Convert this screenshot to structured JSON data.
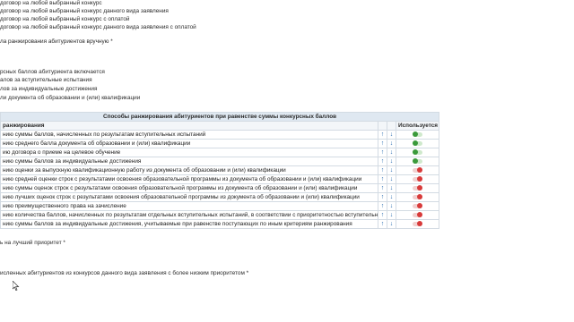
{
  "top_lines": [
    "договор на любой выбранный конкурс",
    "договор на любой выбранный конкурс данного вида заявления",
    "договор на любой выбранный конкурс с оплатой",
    "договор на любой выбранный конкурс данного вида заявления с оплатой"
  ],
  "manual_ranking_label": "ла ранжирования абитуриентов вручную *",
  "score_lines": [
    "рсных баллов абитуриента включается",
    "алов за вступительные испытания",
    "лов за индивидуальные достижения",
    "ли документа об образовании и (или) квалификации"
  ],
  "table": {
    "caption": "Способы ранжирования абитуриентов при равенстве суммы конкурсных баллов",
    "col_method": "ранжирования",
    "col_used": "Используется",
    "up_icon": "arrow-up-icon",
    "down_icon": "arrow-down-icon",
    "rows": [
      {
        "text": "нию суммы баллов, начисленных по результатам вступительных испытаний",
        "used": true
      },
      {
        "text": "нию среднего балла документа об образовании и (или) квалификации",
        "used": true
      },
      {
        "text": "ию договора о приеме на целевое обучение",
        "used": true
      },
      {
        "text": "нию суммы баллов за индивидуальные достижения",
        "used": true
      },
      {
        "text": "нию оценки за выпускную квалификационную работу из документа об образовании и (или) квалификации",
        "used": false
      },
      {
        "text": "нию средней оценки строк с результатами освоения образовательной программы из документа об образовании и (или) квалификации",
        "used": false
      },
      {
        "text": "нию суммы оценок строк с результатами освоения образовательной программы из документа об образовании и (или) квалификации",
        "used": false
      },
      {
        "text": "нию лучших оценок строк с результатами освоения образовательной программы из документа об образовании и (или) квалификации",
        "used": false
      },
      {
        "text": "нию преимущественного права на зачисление",
        "used": false
      },
      {
        "text": "нию количества баллов, начисленных по результатам отдельных вступительных испытаний, в соответствии с приоритетностью вступительных испытаний",
        "used": false
      },
      {
        "text": "нию суммы баллов за индивидуальные достижения, учитываемые при равенстве поступающих по иным критериям ранжирования",
        "used": false
      }
    ]
  },
  "priority_label": "ь на лучший приоритет *",
  "exclude_label": "исленных абитуриентов из конкурсов данного вида заявления с более низким приоритетом *",
  "colors": {
    "toggle_on": "#3b9a3b",
    "toggle_off": "#d83a3a",
    "arrow": "#2f6fb3",
    "caption_bg": "#dfe8f1"
  }
}
